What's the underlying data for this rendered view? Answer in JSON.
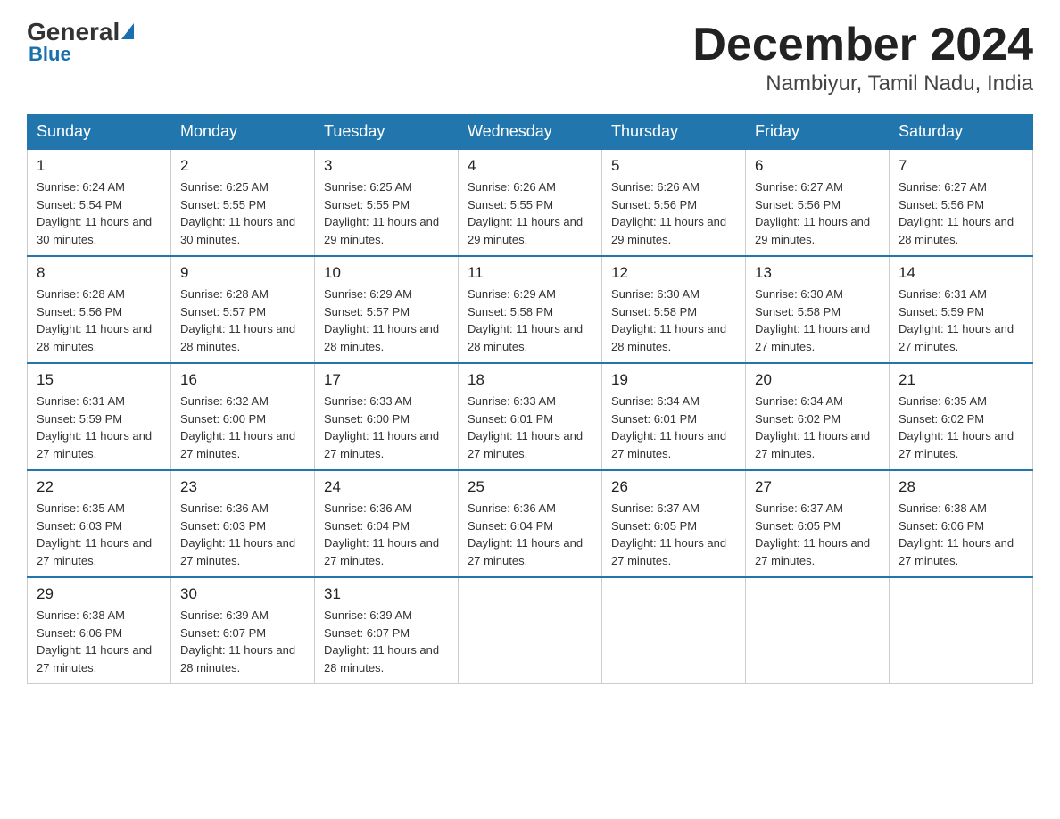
{
  "header": {
    "logo_general": "General",
    "logo_blue": "Blue",
    "month_title": "December 2024",
    "location": "Nambiyur, Tamil Nadu, India"
  },
  "days_of_week": [
    "Sunday",
    "Monday",
    "Tuesday",
    "Wednesday",
    "Thursday",
    "Friday",
    "Saturday"
  ],
  "weeks": [
    [
      {
        "day": "1",
        "sunrise": "6:24 AM",
        "sunset": "5:54 PM",
        "daylight": "11 hours and 30 minutes."
      },
      {
        "day": "2",
        "sunrise": "6:25 AM",
        "sunset": "5:55 PM",
        "daylight": "11 hours and 30 minutes."
      },
      {
        "day": "3",
        "sunrise": "6:25 AM",
        "sunset": "5:55 PM",
        "daylight": "11 hours and 29 minutes."
      },
      {
        "day": "4",
        "sunrise": "6:26 AM",
        "sunset": "5:55 PM",
        "daylight": "11 hours and 29 minutes."
      },
      {
        "day": "5",
        "sunrise": "6:26 AM",
        "sunset": "5:56 PM",
        "daylight": "11 hours and 29 minutes."
      },
      {
        "day": "6",
        "sunrise": "6:27 AM",
        "sunset": "5:56 PM",
        "daylight": "11 hours and 29 minutes."
      },
      {
        "day": "7",
        "sunrise": "6:27 AM",
        "sunset": "5:56 PM",
        "daylight": "11 hours and 28 minutes."
      }
    ],
    [
      {
        "day": "8",
        "sunrise": "6:28 AM",
        "sunset": "5:56 PM",
        "daylight": "11 hours and 28 minutes."
      },
      {
        "day": "9",
        "sunrise": "6:28 AM",
        "sunset": "5:57 PM",
        "daylight": "11 hours and 28 minutes."
      },
      {
        "day": "10",
        "sunrise": "6:29 AM",
        "sunset": "5:57 PM",
        "daylight": "11 hours and 28 minutes."
      },
      {
        "day": "11",
        "sunrise": "6:29 AM",
        "sunset": "5:58 PM",
        "daylight": "11 hours and 28 minutes."
      },
      {
        "day": "12",
        "sunrise": "6:30 AM",
        "sunset": "5:58 PM",
        "daylight": "11 hours and 28 minutes."
      },
      {
        "day": "13",
        "sunrise": "6:30 AM",
        "sunset": "5:58 PM",
        "daylight": "11 hours and 27 minutes."
      },
      {
        "day": "14",
        "sunrise": "6:31 AM",
        "sunset": "5:59 PM",
        "daylight": "11 hours and 27 minutes."
      }
    ],
    [
      {
        "day": "15",
        "sunrise": "6:31 AM",
        "sunset": "5:59 PM",
        "daylight": "11 hours and 27 minutes."
      },
      {
        "day": "16",
        "sunrise": "6:32 AM",
        "sunset": "6:00 PM",
        "daylight": "11 hours and 27 minutes."
      },
      {
        "day": "17",
        "sunrise": "6:33 AM",
        "sunset": "6:00 PM",
        "daylight": "11 hours and 27 minutes."
      },
      {
        "day": "18",
        "sunrise": "6:33 AM",
        "sunset": "6:01 PM",
        "daylight": "11 hours and 27 minutes."
      },
      {
        "day": "19",
        "sunrise": "6:34 AM",
        "sunset": "6:01 PM",
        "daylight": "11 hours and 27 minutes."
      },
      {
        "day": "20",
        "sunrise": "6:34 AM",
        "sunset": "6:02 PM",
        "daylight": "11 hours and 27 minutes."
      },
      {
        "day": "21",
        "sunrise": "6:35 AM",
        "sunset": "6:02 PM",
        "daylight": "11 hours and 27 minutes."
      }
    ],
    [
      {
        "day": "22",
        "sunrise": "6:35 AM",
        "sunset": "6:03 PM",
        "daylight": "11 hours and 27 minutes."
      },
      {
        "day": "23",
        "sunrise": "6:36 AM",
        "sunset": "6:03 PM",
        "daylight": "11 hours and 27 minutes."
      },
      {
        "day": "24",
        "sunrise": "6:36 AM",
        "sunset": "6:04 PM",
        "daylight": "11 hours and 27 minutes."
      },
      {
        "day": "25",
        "sunrise": "6:36 AM",
        "sunset": "6:04 PM",
        "daylight": "11 hours and 27 minutes."
      },
      {
        "day": "26",
        "sunrise": "6:37 AM",
        "sunset": "6:05 PM",
        "daylight": "11 hours and 27 minutes."
      },
      {
        "day": "27",
        "sunrise": "6:37 AM",
        "sunset": "6:05 PM",
        "daylight": "11 hours and 27 minutes."
      },
      {
        "day": "28",
        "sunrise": "6:38 AM",
        "sunset": "6:06 PM",
        "daylight": "11 hours and 27 minutes."
      }
    ],
    [
      {
        "day": "29",
        "sunrise": "6:38 AM",
        "sunset": "6:06 PM",
        "daylight": "11 hours and 27 minutes."
      },
      {
        "day": "30",
        "sunrise": "6:39 AM",
        "sunset": "6:07 PM",
        "daylight": "11 hours and 28 minutes."
      },
      {
        "day": "31",
        "sunrise": "6:39 AM",
        "sunset": "6:07 PM",
        "daylight": "11 hours and 28 minutes."
      },
      null,
      null,
      null,
      null
    ]
  ]
}
